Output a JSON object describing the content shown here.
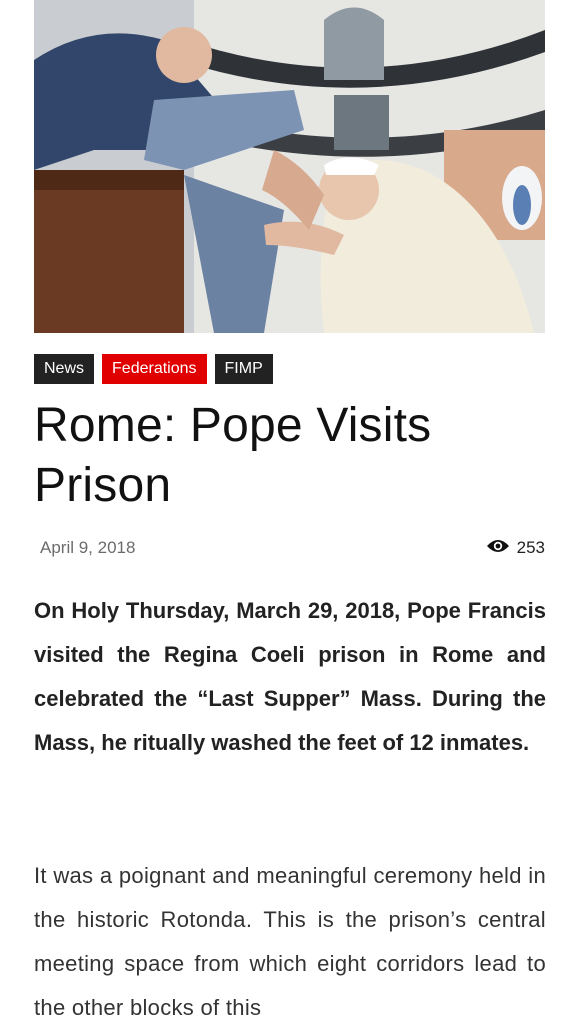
{
  "hero_image": {
    "alt": "Pope washing an inmate's feet in a prison rotunda"
  },
  "tags": [
    {
      "label": "News",
      "color": "#222222"
    },
    {
      "label": "Federations",
      "color": "#e10000"
    },
    {
      "label": "FIMP",
      "color": "#222222"
    }
  ],
  "article": {
    "title": "Rome: Pope Visits Prison",
    "date": "April 9, 2018",
    "views": "253",
    "lead": "On Holy Thursday, March 29, 2018, Pope Francis visited the Regina Coeli prison in Rome and celebrated the “Last Supper” Mass. During the Mass, he ritually washed the feet of 12 inmates.",
    "body": "It was a poignant and meaningful ceremony held in the historic Rotonda. This is the prison’s central meeting space from which eight corridors lead to the other blocks of this"
  },
  "icons": {
    "views": "eye-icon"
  }
}
